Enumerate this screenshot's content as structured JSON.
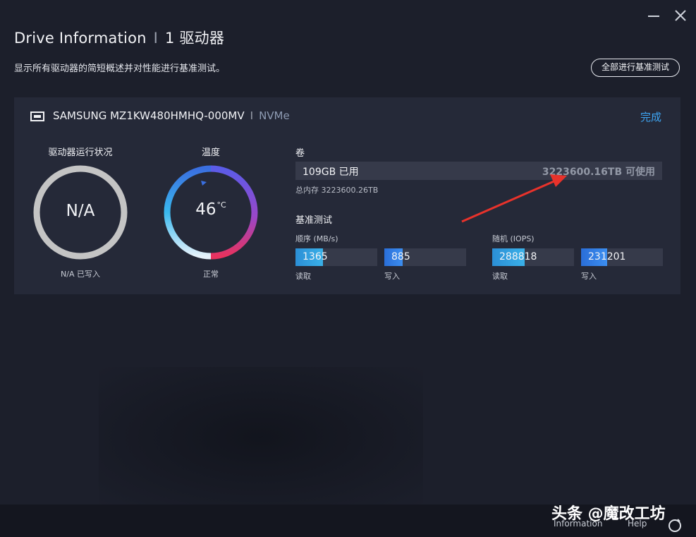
{
  "window": {
    "title": "Drive Information",
    "title_sep": "I",
    "drive_count": "1 驱动器",
    "subtitle": "显示所有驱动器的简短概述并对性能进行基准测试。",
    "benchmark_all_label": "全部进行基准测试"
  },
  "drive": {
    "name": "SAMSUNG MZ1KW480HMHQ-000MV",
    "sep": "I",
    "interface": "NVMe",
    "done_label": "完成",
    "health": {
      "title": "驱动器运行状况",
      "value": "N/A",
      "caption": "N/A 已写入"
    },
    "temperature": {
      "title": "温度",
      "value": "46",
      "unit": "°C",
      "caption": "正常"
    },
    "volume": {
      "label": "卷",
      "used": "109GB 已用",
      "free": "3223600.16TB 可使用",
      "total": "总内存 3223600.26TB"
    },
    "benchmark": {
      "label": "基准测试",
      "sequential": {
        "label": "顺序 (MB/s)",
        "read": {
          "value": "1365",
          "label": "读取",
          "fill_fraction": 0.34
        },
        "write": {
          "value": "885",
          "label": "写入",
          "fill_fraction": 0.22
        }
      },
      "random": {
        "label": "随机 (IOPS)",
        "read": {
          "value": "288818",
          "label": "读取",
          "fill_fraction": 0.4
        },
        "write": {
          "value": "231201",
          "label": "写入",
          "fill_fraction": 0.32
        }
      }
    }
  },
  "footer": {
    "information": "Information",
    "help": "Help"
  },
  "watermark": "头条 @魔改工坊",
  "colors": {
    "accent_blue": "#3ea5f3",
    "arrow_red": "#e8322b",
    "ring_gray": "#c4c4c4"
  }
}
